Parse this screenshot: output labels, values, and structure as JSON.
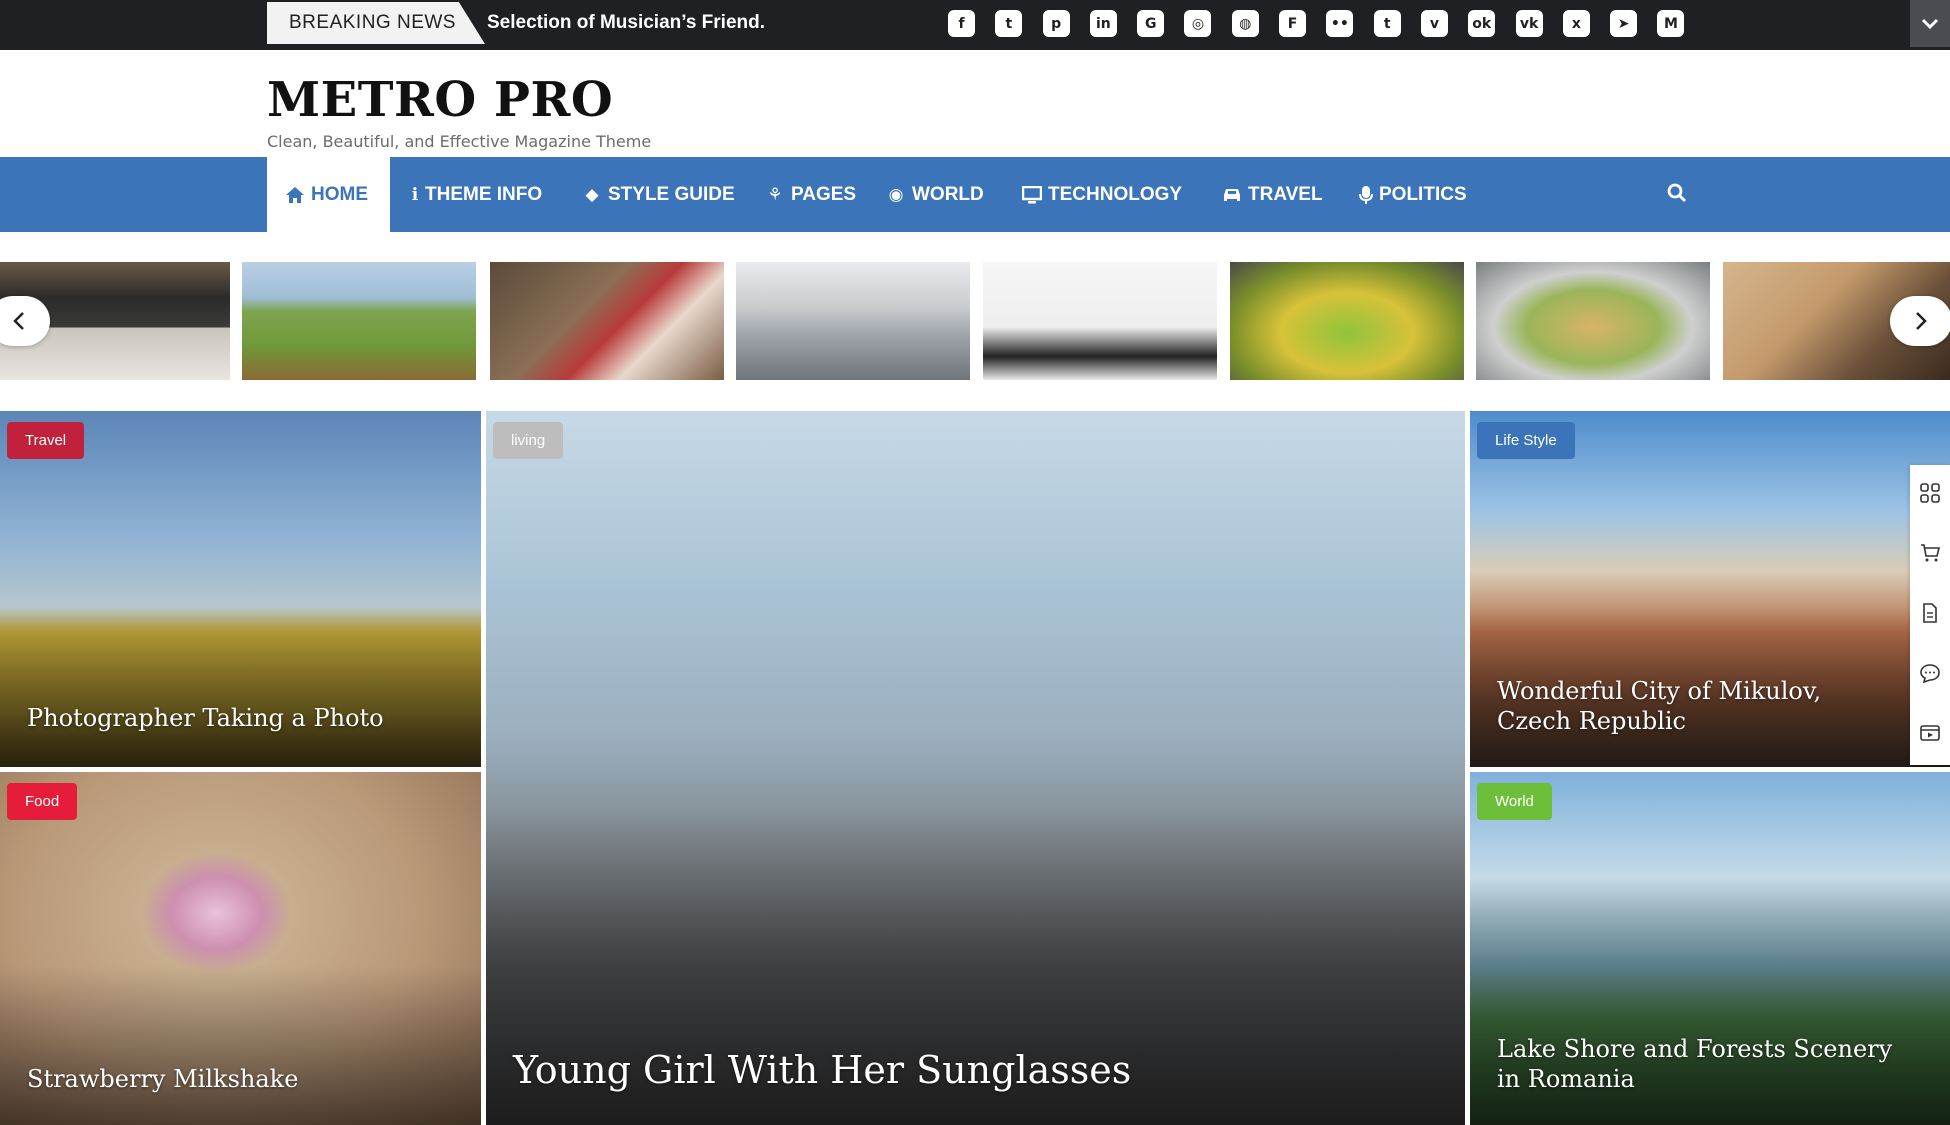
{
  "topbar": {
    "breaking_label": "BREAKING NEWS",
    "ticker_text": "Selection of Musician’s Friend.",
    "socials": [
      {
        "icon": "facebook-icon",
        "glyph": "f"
      },
      {
        "icon": "twitter-icon",
        "glyph": "t"
      },
      {
        "icon": "pinterest-icon",
        "glyph": "p"
      },
      {
        "icon": "linkedin-icon",
        "glyph": "in"
      },
      {
        "icon": "google-icon",
        "glyph": "G"
      },
      {
        "icon": "instagram-icon",
        "glyph": "◎"
      },
      {
        "icon": "dribbble-icon",
        "glyph": "◍"
      },
      {
        "icon": "foursquare-icon",
        "glyph": "F"
      },
      {
        "icon": "flickr-icon",
        "glyph": "••"
      },
      {
        "icon": "tumblr-icon",
        "glyph": "t"
      },
      {
        "icon": "vimeo-icon",
        "glyph": "v"
      },
      {
        "icon": "odnoklassniki-icon",
        "glyph": "ok"
      },
      {
        "icon": "vk-icon",
        "glyph": "vk"
      },
      {
        "icon": "xing-icon",
        "glyph": "x"
      },
      {
        "icon": "telegram-icon",
        "glyph": "➤"
      },
      {
        "icon": "medium-icon",
        "glyph": "M"
      }
    ]
  },
  "site": {
    "title": "METRO PRO",
    "tagline": "Clean, Beautiful, and Effective Magazine Theme"
  },
  "nav": {
    "items": [
      {
        "label": "HOME",
        "icon": "home-icon"
      },
      {
        "label": "THEME INFO",
        "icon": "info-icon"
      },
      {
        "label": "STYLE GUIDE",
        "icon": "eraser-icon"
      },
      {
        "label": "PAGES",
        "icon": "fan-icon"
      },
      {
        "label": "WORLD",
        "icon": "globe-icon"
      },
      {
        "label": "TECHNOLOGY",
        "icon": "desktop-icon"
      },
      {
        "label": "TRAVEL",
        "icon": "car-icon"
      },
      {
        "label": "POLITICS",
        "icon": "microphone-icon"
      }
    ],
    "search_icon": "search-icon"
  },
  "slider": {
    "thumbnails": [
      "radio-receiver",
      "man-with-guitar",
      "smoothie-picnic",
      "woman-jogging-bridge",
      "man-exercising",
      "fruit-bowl",
      "plated-dish",
      "book-glasses"
    ]
  },
  "featured": [
    {
      "category": "Travel",
      "category_color": "#c1213a",
      "title": "Photographer Taking a Photo"
    },
    {
      "category": "living",
      "category_color": "#bdbdbd",
      "title": "Young Girl With Her Sunglasses"
    },
    {
      "category": "Life Style",
      "category_color": "#3b74b8",
      "title": "Wonderful City of Mikulov, Czech Republic"
    },
    {
      "category": "Food",
      "category_color": "#e51c3a",
      "title": "Strawberry Milkshake"
    },
    {
      "category": "World",
      "category_color": "#6dbf3a",
      "title": "Lake Shore and Forests Scenery in Romania"
    }
  ],
  "side_tools": [
    "grid-icon",
    "cart-icon",
    "document-icon",
    "chat-icon",
    "video-icon"
  ]
}
